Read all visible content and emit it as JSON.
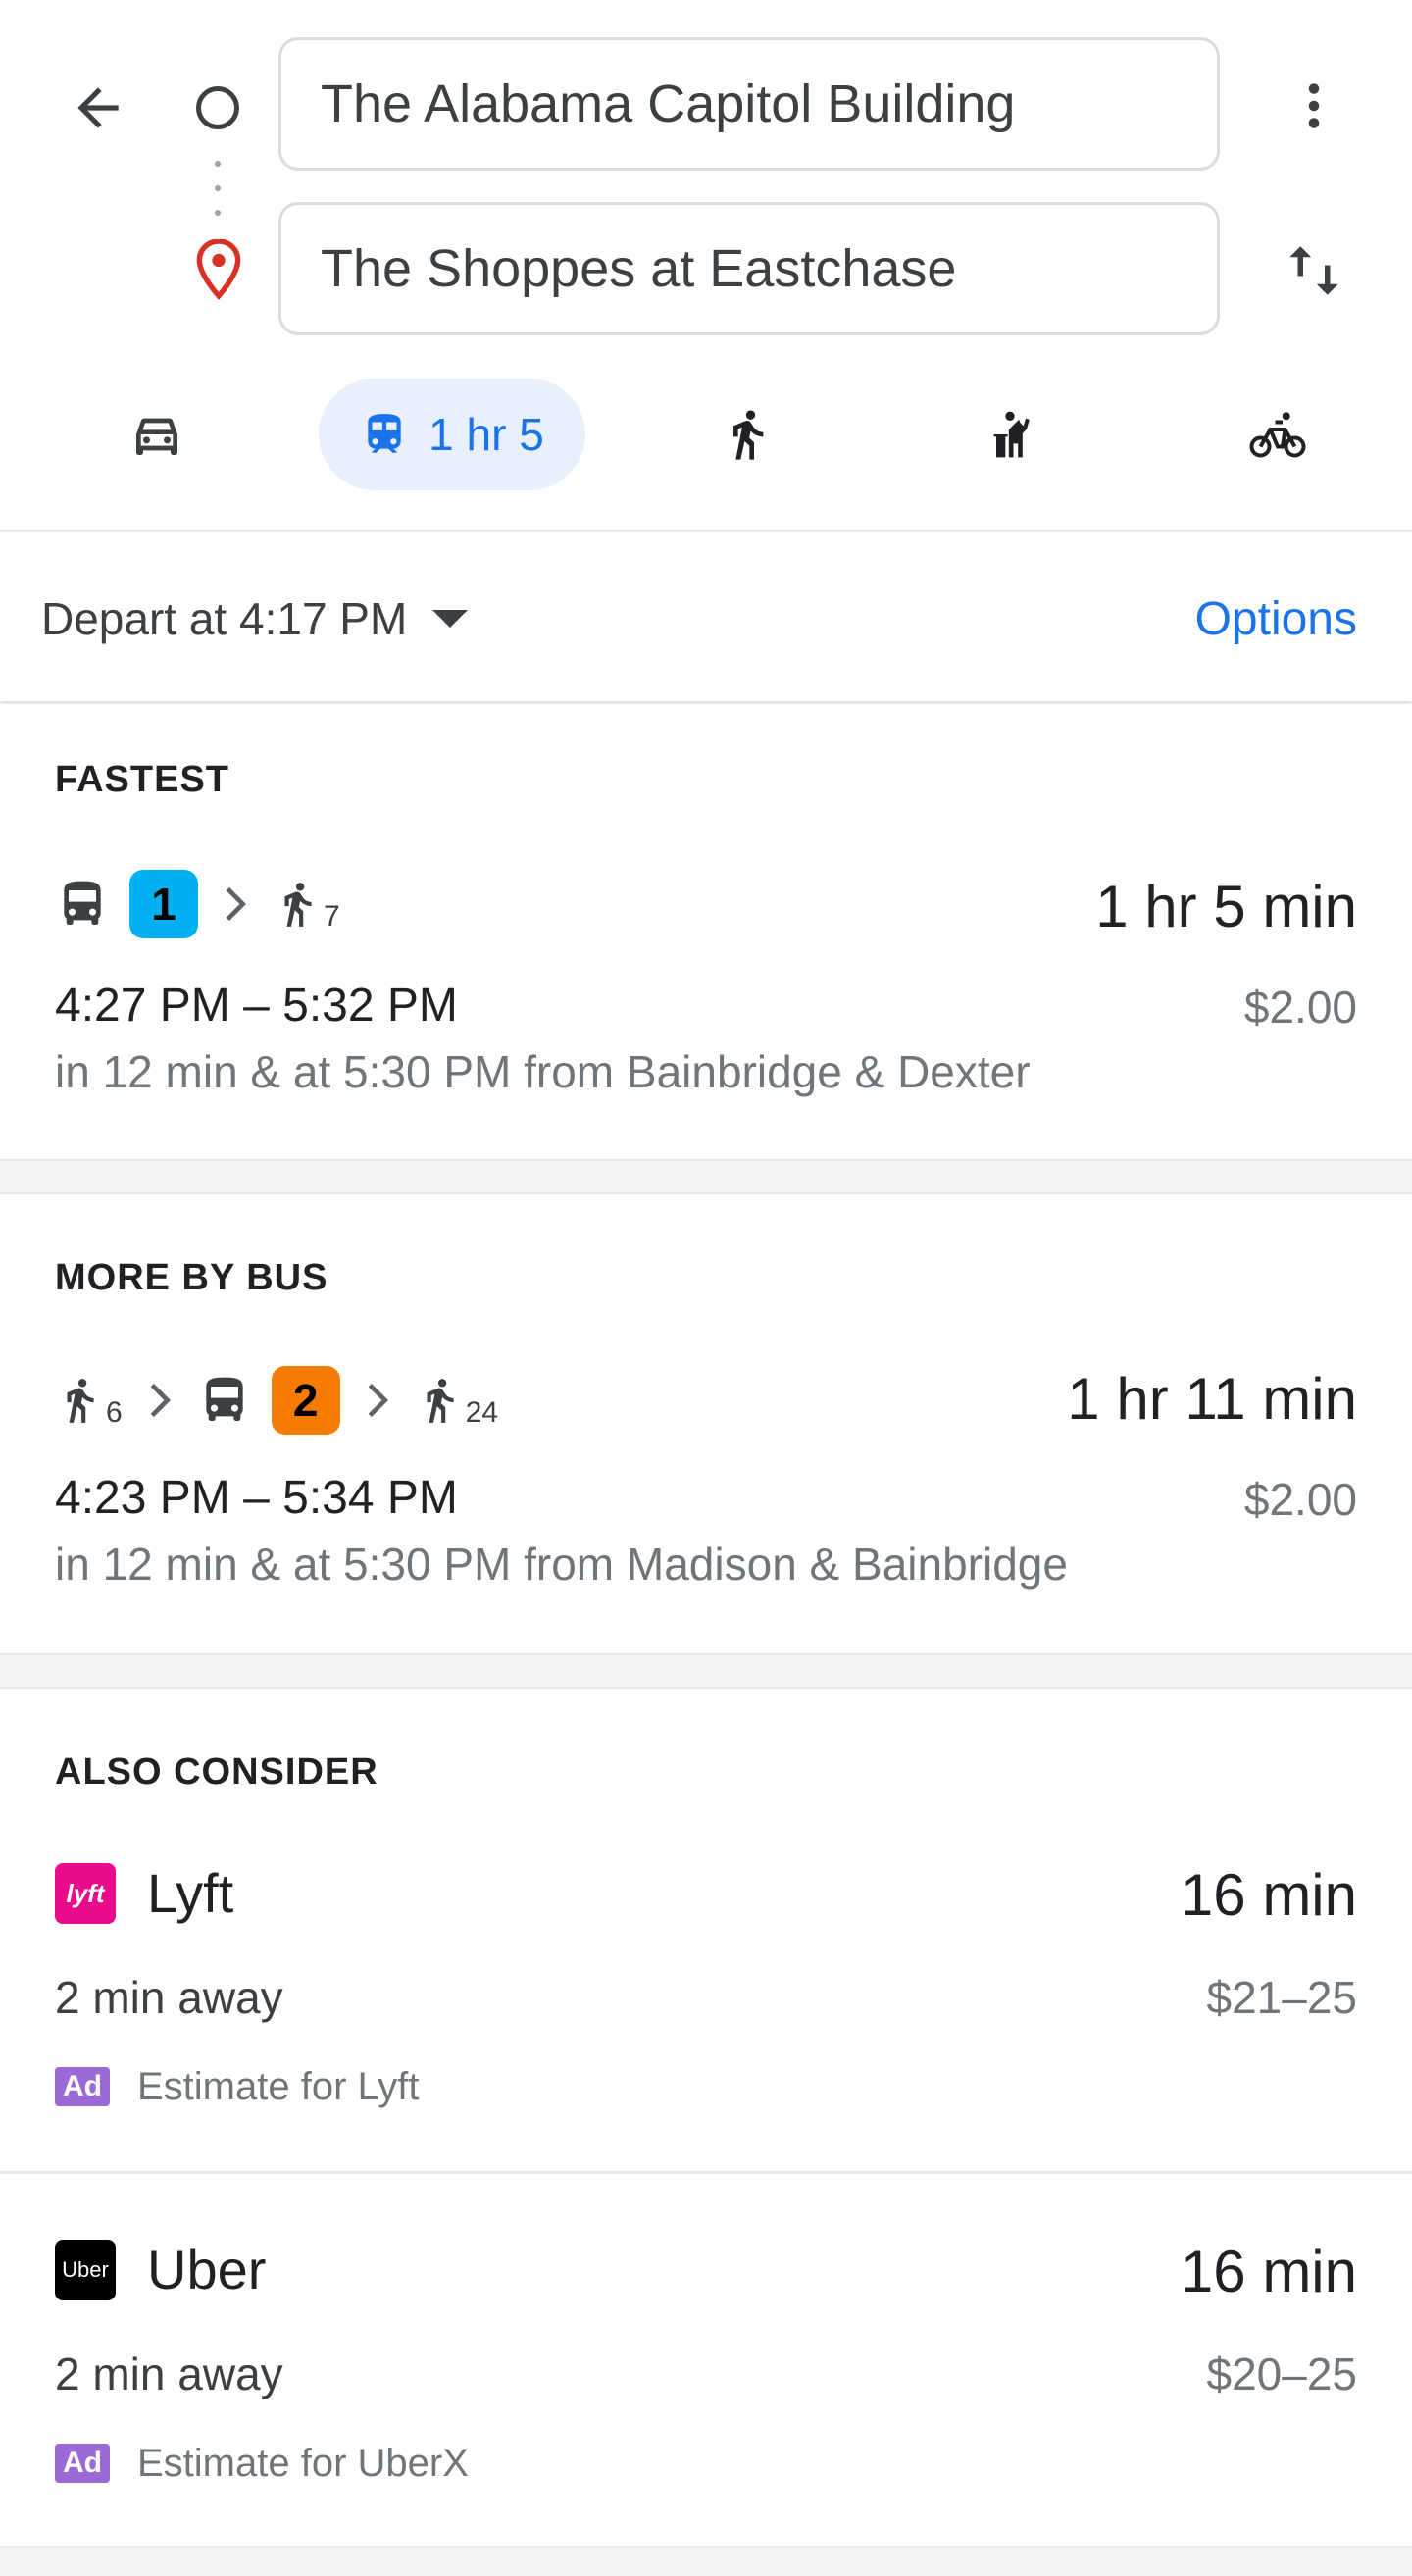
{
  "search": {
    "origin": "The Alabama Capitol Building",
    "destination": "The Shoppes at Eastchase"
  },
  "modes": {
    "transit_label": "1 hr 5"
  },
  "depart": {
    "label": "Depart at 4:17 PM",
    "options_label": "Options"
  },
  "fastest": {
    "heading": "FASTEST",
    "bus_line": "1",
    "bus_line_color": "#00b0f0",
    "walk_minutes": "7",
    "duration": "1 hr 5 min",
    "times": "4:27 PM – 5:32 PM",
    "fare": "$2.00",
    "detail": "in 12 min & at 5:30 PM from Bainbridge & Dexter"
  },
  "more_by_bus": {
    "heading": "MORE BY BUS",
    "walk_before_minutes": "6",
    "bus_line": "2",
    "bus_line_color": "#f57c00",
    "walk_after_minutes": "24",
    "duration": "1 hr 11 min",
    "times": "4:23 PM – 5:34 PM",
    "fare": "$2.00",
    "detail": "in 12 min & at 5:30 PM from Madison & Bainbridge"
  },
  "also_consider": {
    "heading": "ALSO CONSIDER",
    "options": [
      {
        "name": "Lyft",
        "logo_text": "lyft",
        "logo_color": "#ea0b8c",
        "duration": "16 min",
        "away": "2 min away",
        "price": "$21–25",
        "ad_label": "Ad",
        "estimate": "Estimate for Lyft"
      },
      {
        "name": "Uber",
        "logo_text": "Uber",
        "logo_color": "#000000",
        "duration": "16 min",
        "away": "2 min away",
        "price": "$20–25",
        "ad_label": "Ad",
        "estimate": "Estimate for UberX"
      }
    ]
  },
  "colors": {
    "accent": "#1a73e8",
    "accent_bg": "#e8f0fe",
    "destination_pin": "#d93025",
    "ad_badge": "#9c6ad6"
  },
  "icons": [
    "arrow-back-icon",
    "origin-circle-icon",
    "destination-pin-icon",
    "more-vert-icon",
    "swap-icon",
    "car-icon",
    "train-icon",
    "walk-icon",
    "ride-hail-icon",
    "bike-icon",
    "bus-icon",
    "chevron-right-icon",
    "caret-down-icon"
  ]
}
